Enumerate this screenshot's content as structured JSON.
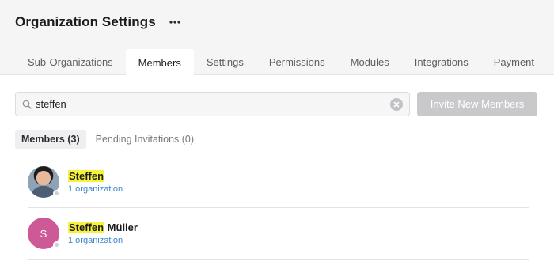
{
  "header": {
    "title": "Organization Settings",
    "more_icon": "more-horizontal-icon"
  },
  "tabs": [
    {
      "label": "Sub-Organizations",
      "active": false
    },
    {
      "label": "Members",
      "active": true
    },
    {
      "label": "Settings",
      "active": false
    },
    {
      "label": "Permissions",
      "active": false
    },
    {
      "label": "Modules",
      "active": false
    },
    {
      "label": "Integrations",
      "active": false
    },
    {
      "label": "Payment",
      "active": false
    }
  ],
  "search": {
    "value": "steffen",
    "placeholder": "",
    "icon": "search-icon",
    "clear_icon": "clear-icon"
  },
  "invite_button": {
    "label": "Invite New Members",
    "enabled": false
  },
  "subtabs": [
    {
      "label": "Members (3)",
      "active": true
    },
    {
      "label": "Pending Invitations (0)",
      "active": false
    }
  ],
  "members": [
    {
      "name_highlight": "Steffen",
      "name_rest": "",
      "orgs": "1 organization",
      "avatar": "photo",
      "initial": ""
    },
    {
      "name_highlight": "Steffen",
      "name_rest": " Müller",
      "orgs": "1 organization",
      "avatar": "initial",
      "initial": "S"
    }
  ],
  "colors": {
    "header_bg": "#f5f5f6",
    "highlight": "#f7f33b",
    "link": "#3d86c6",
    "avatar_initial_bg": "#cd5a96",
    "disabled_button": "#c9c9cc"
  }
}
